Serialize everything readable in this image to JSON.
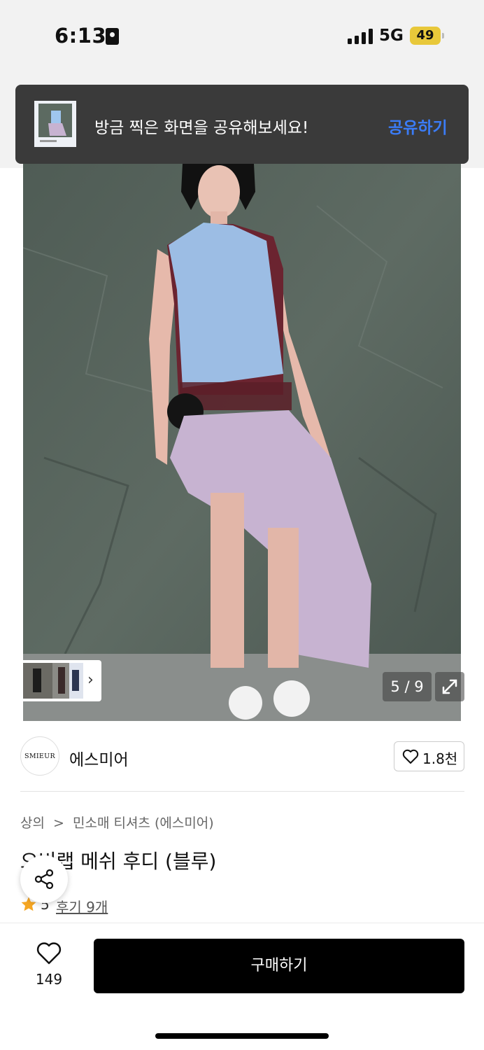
{
  "status_bar": {
    "time": "6:13",
    "network": "5G",
    "battery": "49"
  },
  "toast": {
    "message": "방금 찍은 화면을 공유해보세요!",
    "action": "공유하기"
  },
  "gallery": {
    "counter": "5 / 9"
  },
  "brand": {
    "logo_text": "SMIEUR",
    "name": "에스미어",
    "likes": "1.8천"
  },
  "breadcrumb": {
    "category": "상의",
    "separator": ">",
    "subcategory": "민소매 티셔츠 (에스미어)"
  },
  "product": {
    "title": "오비랩 메쉬 후디 (블루)",
    "rating": "5",
    "reviews": "후기 9개"
  },
  "bottom_bar": {
    "wish_count": "149",
    "buy_label": "구매하기"
  },
  "icons": [
    "lock-icon",
    "signal-icon",
    "battery-icon",
    "chevron-right-icon",
    "expand-icon",
    "heart-icon",
    "share-icon",
    "star-icon"
  ],
  "colors": {
    "toast_bg": "#3a3a3a",
    "toast_action": "#3b7cf6",
    "buy_button": "#000000",
    "star": "#f5a623",
    "battery": "#e8c83a"
  }
}
